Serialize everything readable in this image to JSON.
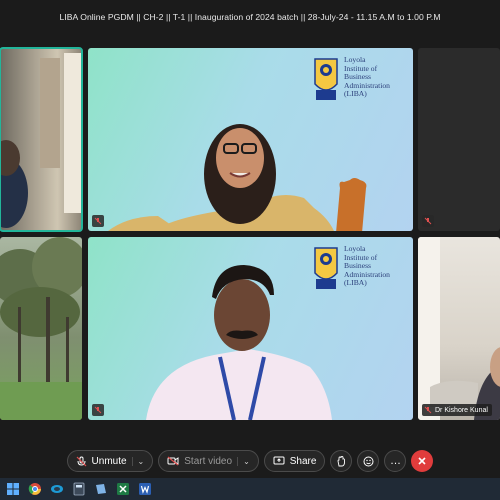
{
  "meeting": {
    "title": "LIBA Online PGDM || CH-2 || T-1 || Inauguration of 2024 batch || 28-July-24 - 11.15 A.M to 1.00 P.M"
  },
  "logo": {
    "line1": "Loyola",
    "line2": "Institute of",
    "line3": "Business",
    "line4": "Administration",
    "line5": "(LIBA)",
    "badge": "LIBA"
  },
  "participants": [
    {
      "slot": "top-left",
      "muted": false,
      "active": true
    },
    {
      "slot": "top-center",
      "muted": true
    },
    {
      "slot": "top-right",
      "muted": true
    },
    {
      "slot": "bottom-left",
      "muted": false
    },
    {
      "slot": "bottom-center",
      "muted": true
    },
    {
      "slot": "bottom-right",
      "muted": true,
      "name": "Dr Kishore Kunal"
    }
  ],
  "toolbar": {
    "unmute_label": "Unmute",
    "start_video_label": "Start video",
    "share_label": "Share",
    "more_glyph": "…"
  },
  "colors": {
    "leave": "#e03c3c",
    "active_speaker": "#22b59a",
    "muted_icon": "#e05050"
  }
}
